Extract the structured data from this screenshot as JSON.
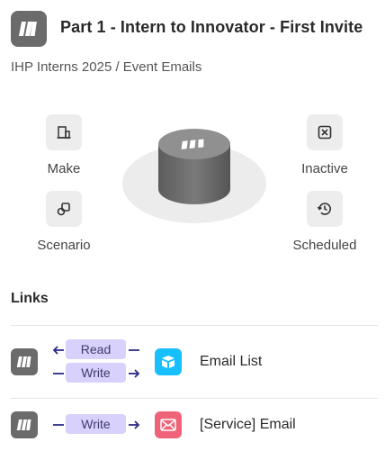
{
  "header": {
    "title": "Part 1 - Intern to Innovator - First Invite",
    "breadcrumb": "IHP Interns 2025 / Event Emails",
    "app_icon": "make-logo-icon"
  },
  "status": {
    "make_label": "Make",
    "scenario_label": "Scenario",
    "inactive_label": "Inactive",
    "scheduled_label": "Scheduled",
    "icons": [
      "building-icon",
      "scenario-icon",
      "inactive-x-icon",
      "clock-history-icon"
    ]
  },
  "links": {
    "title": "Links",
    "items": [
      {
        "service": "Email List",
        "service_icon": "airtable-icon",
        "modes": [
          "Read",
          "Write"
        ]
      },
      {
        "service": "[Service] Email",
        "service_icon": "email-icon",
        "modes": [
          "Write"
        ]
      }
    ]
  },
  "colors": {
    "app_icon_bg": "#6b6b6b",
    "pill_bg": "#d8d1fb",
    "arrow": "#2b2a86",
    "airtable_bg": "#18bfff",
    "email_bg": "#f06277"
  }
}
